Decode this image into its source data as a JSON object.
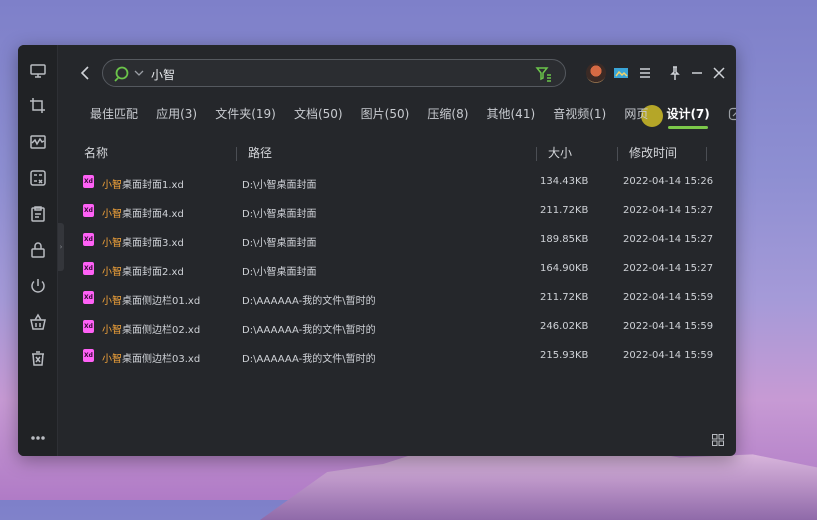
{
  "search": {
    "query": "小智"
  },
  "tabs": [
    {
      "label": "最佳匹配"
    },
    {
      "label": "应用(3)"
    },
    {
      "label": "文件夹(19)"
    },
    {
      "label": "文档(50)"
    },
    {
      "label": "图片(50)"
    },
    {
      "label": "压缩(8)"
    },
    {
      "label": "其他(41)"
    },
    {
      "label": "音视频(1)"
    },
    {
      "label": "网页"
    },
    {
      "label": "设计(7)",
      "active": true
    }
  ],
  "table": {
    "columns": {
      "name": "名称",
      "path": "路径",
      "size": "大小",
      "modified": "修改时间"
    },
    "file_icon_text": "Xd",
    "rows": [
      {
        "name_highlight": "小智",
        "name_rest": "桌面封面1.xd",
        "path": "D:\\小智桌面封面",
        "size": "134.43KB",
        "modified": "2022-04-14 15:26"
      },
      {
        "name_highlight": "小智",
        "name_rest": "桌面封面4.xd",
        "path": "D:\\小智桌面封面",
        "size": "211.72KB",
        "modified": "2022-04-14 15:27"
      },
      {
        "name_highlight": "小智",
        "name_rest": "桌面封面3.xd",
        "path": "D:\\小智桌面封面",
        "size": "189.85KB",
        "modified": "2022-04-14 15:27"
      },
      {
        "name_highlight": "小智",
        "name_rest": "桌面封面2.xd",
        "path": "D:\\小智桌面封面",
        "size": "164.90KB",
        "modified": "2022-04-14 15:27"
      },
      {
        "name_highlight": "小智",
        "name_rest": "桌面侧边栏01.xd",
        "path": "D:\\AAAAAA-我的文件\\暂时的",
        "size": "211.72KB",
        "modified": "2022-04-14 15:59"
      },
      {
        "name_highlight": "小智",
        "name_rest": "桌面侧边栏02.xd",
        "path": "D:\\AAAAAA-我的文件\\暂时的",
        "size": "246.02KB",
        "modified": "2022-04-14 15:59"
      },
      {
        "name_highlight": "小智",
        "name_rest": "桌面侧边栏03.xd",
        "path": "D:\\AAAAAA-我的文件\\暂时的",
        "size": "215.93KB",
        "modified": "2022-04-14 15:59"
      }
    ]
  },
  "rail": {
    "icons": [
      "monitor-icon",
      "crop-icon",
      "activity-icon",
      "calculator-icon",
      "clipboard-icon",
      "lock-icon",
      "power-icon",
      "basket-icon",
      "trash-icon",
      "more-icon"
    ]
  },
  "colors": {
    "accent": "#7cc84a",
    "highlight": "#f2a33a",
    "xd_icon": "#ff61f6"
  }
}
